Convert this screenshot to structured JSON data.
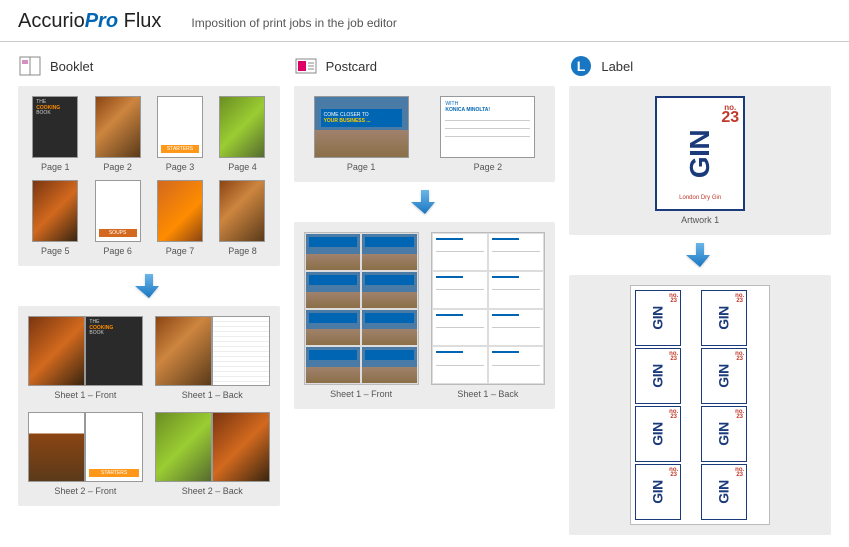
{
  "header": {
    "logo_accurio": "Accurio",
    "logo_pro": "Pro",
    "logo_flux": "Flux",
    "subtitle": "Imposition of print jobs in the job editor"
  },
  "columns": {
    "booklet": {
      "title": "Booklet",
      "pages": [
        "Page 1",
        "Page 2",
        "Page 3",
        "Page 4",
        "Page 5",
        "Page 6",
        "Page 7",
        "Page 8"
      ],
      "sheets": [
        "Sheet 1 – Front",
        "Sheet 1 – Back",
        "Sheet 2 – Front",
        "Sheet 2 – Back"
      ],
      "cover_title1": "THE",
      "cover_title2": "COOKING",
      "cover_title3": "BOOK",
      "starters": "STARTERS",
      "soups": "SOUPS"
    },
    "postcard": {
      "title": "Postcard",
      "pages": [
        "Page 1",
        "Page 2"
      ],
      "sheets": [
        "Sheet 1 – Front",
        "Sheet 1 – Back"
      ],
      "banner1": "COME CLOSER TO",
      "banner2": "YOUR BUSINESS ...",
      "back1": "WITH",
      "back2": "KONICA MINOLTA!"
    },
    "label": {
      "title": "Label",
      "artwork": "Artwork 1",
      "gin_text": "GIN",
      "gin_no": "no.",
      "gin_num": "23",
      "gin_sub": "London Dry Gin"
    }
  }
}
